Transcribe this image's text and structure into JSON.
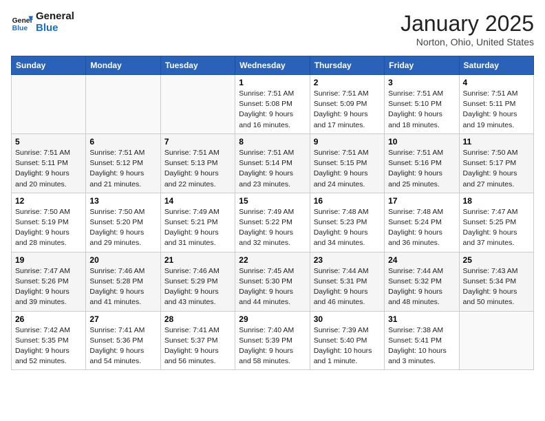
{
  "header": {
    "logo_line1": "General",
    "logo_line2": "Blue",
    "month": "January 2025",
    "location": "Norton, Ohio, United States"
  },
  "weekdays": [
    "Sunday",
    "Monday",
    "Tuesday",
    "Wednesday",
    "Thursday",
    "Friday",
    "Saturday"
  ],
  "weeks": [
    [
      {
        "day": "",
        "info": ""
      },
      {
        "day": "",
        "info": ""
      },
      {
        "day": "",
        "info": ""
      },
      {
        "day": "1",
        "info": "Sunrise: 7:51 AM\nSunset: 5:08 PM\nDaylight: 9 hours\nand 16 minutes."
      },
      {
        "day": "2",
        "info": "Sunrise: 7:51 AM\nSunset: 5:09 PM\nDaylight: 9 hours\nand 17 minutes."
      },
      {
        "day": "3",
        "info": "Sunrise: 7:51 AM\nSunset: 5:10 PM\nDaylight: 9 hours\nand 18 minutes."
      },
      {
        "day": "4",
        "info": "Sunrise: 7:51 AM\nSunset: 5:11 PM\nDaylight: 9 hours\nand 19 minutes."
      }
    ],
    [
      {
        "day": "5",
        "info": "Sunrise: 7:51 AM\nSunset: 5:11 PM\nDaylight: 9 hours\nand 20 minutes."
      },
      {
        "day": "6",
        "info": "Sunrise: 7:51 AM\nSunset: 5:12 PM\nDaylight: 9 hours\nand 21 minutes."
      },
      {
        "day": "7",
        "info": "Sunrise: 7:51 AM\nSunset: 5:13 PM\nDaylight: 9 hours\nand 22 minutes."
      },
      {
        "day": "8",
        "info": "Sunrise: 7:51 AM\nSunset: 5:14 PM\nDaylight: 9 hours\nand 23 minutes."
      },
      {
        "day": "9",
        "info": "Sunrise: 7:51 AM\nSunset: 5:15 PM\nDaylight: 9 hours\nand 24 minutes."
      },
      {
        "day": "10",
        "info": "Sunrise: 7:51 AM\nSunset: 5:16 PM\nDaylight: 9 hours\nand 25 minutes."
      },
      {
        "day": "11",
        "info": "Sunrise: 7:50 AM\nSunset: 5:17 PM\nDaylight: 9 hours\nand 27 minutes."
      }
    ],
    [
      {
        "day": "12",
        "info": "Sunrise: 7:50 AM\nSunset: 5:19 PM\nDaylight: 9 hours\nand 28 minutes."
      },
      {
        "day": "13",
        "info": "Sunrise: 7:50 AM\nSunset: 5:20 PM\nDaylight: 9 hours\nand 29 minutes."
      },
      {
        "day": "14",
        "info": "Sunrise: 7:49 AM\nSunset: 5:21 PM\nDaylight: 9 hours\nand 31 minutes."
      },
      {
        "day": "15",
        "info": "Sunrise: 7:49 AM\nSunset: 5:22 PM\nDaylight: 9 hours\nand 32 minutes."
      },
      {
        "day": "16",
        "info": "Sunrise: 7:48 AM\nSunset: 5:23 PM\nDaylight: 9 hours\nand 34 minutes."
      },
      {
        "day": "17",
        "info": "Sunrise: 7:48 AM\nSunset: 5:24 PM\nDaylight: 9 hours\nand 36 minutes."
      },
      {
        "day": "18",
        "info": "Sunrise: 7:47 AM\nSunset: 5:25 PM\nDaylight: 9 hours\nand 37 minutes."
      }
    ],
    [
      {
        "day": "19",
        "info": "Sunrise: 7:47 AM\nSunset: 5:26 PM\nDaylight: 9 hours\nand 39 minutes."
      },
      {
        "day": "20",
        "info": "Sunrise: 7:46 AM\nSunset: 5:28 PM\nDaylight: 9 hours\nand 41 minutes."
      },
      {
        "day": "21",
        "info": "Sunrise: 7:46 AM\nSunset: 5:29 PM\nDaylight: 9 hours\nand 43 minutes."
      },
      {
        "day": "22",
        "info": "Sunrise: 7:45 AM\nSunset: 5:30 PM\nDaylight: 9 hours\nand 44 minutes."
      },
      {
        "day": "23",
        "info": "Sunrise: 7:44 AM\nSunset: 5:31 PM\nDaylight: 9 hours\nand 46 minutes."
      },
      {
        "day": "24",
        "info": "Sunrise: 7:44 AM\nSunset: 5:32 PM\nDaylight: 9 hours\nand 48 minutes."
      },
      {
        "day": "25",
        "info": "Sunrise: 7:43 AM\nSunset: 5:34 PM\nDaylight: 9 hours\nand 50 minutes."
      }
    ],
    [
      {
        "day": "26",
        "info": "Sunrise: 7:42 AM\nSunset: 5:35 PM\nDaylight: 9 hours\nand 52 minutes."
      },
      {
        "day": "27",
        "info": "Sunrise: 7:41 AM\nSunset: 5:36 PM\nDaylight: 9 hours\nand 54 minutes."
      },
      {
        "day": "28",
        "info": "Sunrise: 7:41 AM\nSunset: 5:37 PM\nDaylight: 9 hours\nand 56 minutes."
      },
      {
        "day": "29",
        "info": "Sunrise: 7:40 AM\nSunset: 5:39 PM\nDaylight: 9 hours\nand 58 minutes."
      },
      {
        "day": "30",
        "info": "Sunrise: 7:39 AM\nSunset: 5:40 PM\nDaylight: 10 hours\nand 1 minute."
      },
      {
        "day": "31",
        "info": "Sunrise: 7:38 AM\nSunset: 5:41 PM\nDaylight: 10 hours\nand 3 minutes."
      },
      {
        "day": "",
        "info": ""
      }
    ]
  ]
}
